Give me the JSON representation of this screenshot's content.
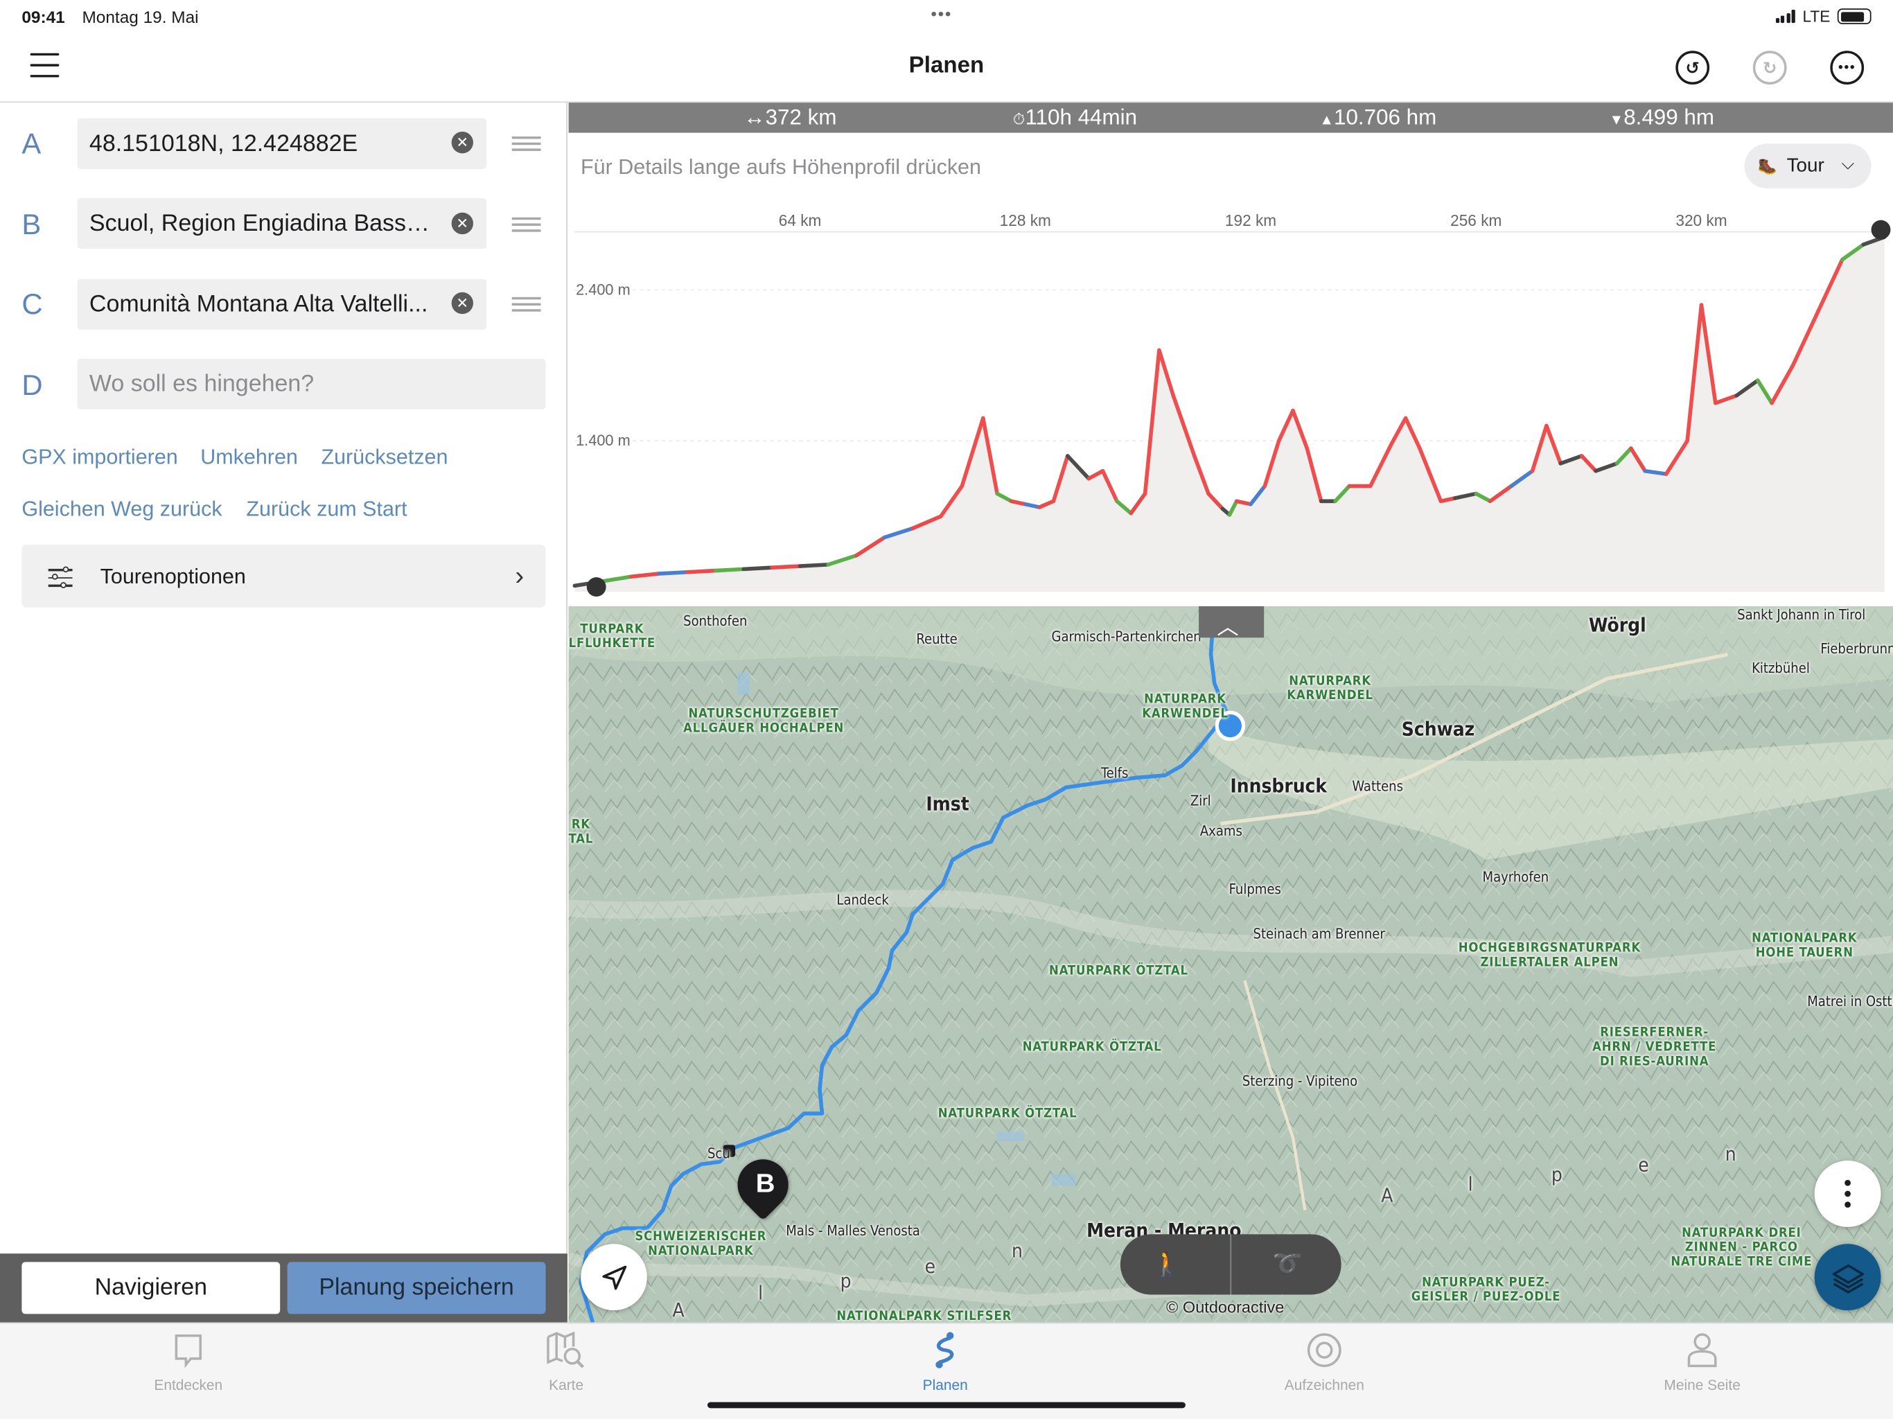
{
  "status_bar": {
    "time": "09:41",
    "date": "Montag 19. Mai",
    "network": "LTE"
  },
  "header": {
    "title": "Planen"
  },
  "waypoints": [
    {
      "letter": "A",
      "value": "48.151018N, 12.424882E",
      "placeholder": ""
    },
    {
      "letter": "B",
      "value": "Scuol, Region Engiadina Bassa...",
      "placeholder": ""
    },
    {
      "letter": "C",
      "value": "Comunità Montana Alta Valtelli...",
      "placeholder": ""
    },
    {
      "letter": "D",
      "value": "",
      "placeholder": "Wo soll es hingehen?"
    }
  ],
  "links": {
    "gpx_import": "GPX importieren",
    "reverse": "Umkehren",
    "reset": "Zurücksetzen",
    "same_way_back": "Gleichen Weg zurück",
    "back_to_start": "Zurück zum Start"
  },
  "tour_options": {
    "label": "Tourenoptionen"
  },
  "actions": {
    "navigate": "Navigieren",
    "save": "Planung speichern"
  },
  "stats": {
    "distance": "372 km",
    "duration": "110h 44min",
    "ascent": "10.706 hm",
    "descent": "8.499 hm"
  },
  "profile": {
    "hint": "Für Details lange aufs Höhenprofil drücken",
    "activity": "Tour"
  },
  "chart_data": {
    "type": "area",
    "x_tick_labels": [
      "64 km",
      "128 km",
      "192 km",
      "256 km",
      "320 km"
    ],
    "x_ticks": [
      64,
      128,
      192,
      256,
      320
    ],
    "y_tick_labels": [
      "2.400 m",
      "1.400 m"
    ],
    "y_ticks": [
      2400,
      1400
    ],
    "xlim": [
      0,
      372
    ],
    "ylim": [
      400,
      2800
    ],
    "x": [
      0,
      8,
      16,
      24,
      32,
      40,
      48,
      56,
      64,
      72,
      80,
      88,
      96,
      104,
      110,
      116,
      118,
      120,
      124,
      128,
      132,
      136,
      140,
      146,
      150,
      154,
      158,
      162,
      166,
      170,
      176,
      180,
      184,
      186,
      188,
      192,
      196,
      200,
      204,
      208,
      212,
      216,
      220,
      226,
      232,
      236,
      240,
      246,
      250,
      256,
      260,
      266,
      272,
      276,
      280,
      286,
      290,
      296,
      300,
      304,
      310,
      316,
      320,
      324,
      330,
      336,
      340,
      346,
      352,
      360,
      366,
      372
    ],
    "y": [
      440,
      470,
      500,
      520,
      530,
      540,
      550,
      560,
      570,
      580,
      640,
      760,
      820,
      900,
      1100,
      1550,
      1300,
      1050,
      1000,
      980,
      960,
      1000,
      1300,
      1150,
      1200,
      1000,
      920,
      1050,
      2000,
      1700,
      1300,
      1050,
      950,
      910,
      1000,
      980,
      1100,
      1400,
      1600,
      1350,
      1000,
      1000,
      1100,
      1100,
      1380,
      1550,
      1350,
      1000,
      1020,
      1050,
      1000,
      1100,
      1200,
      1500,
      1250,
      1300,
      1200,
      1250,
      1350,
      1200,
      1180,
      1400,
      2300,
      1650,
      1700,
      1800,
      1650,
      1900,
      2200,
      2600,
      2700,
      2750
    ]
  },
  "map": {
    "labels": {
      "sonthofen": "Sonthofen",
      "reutte": "Reutte",
      "garmisch": "Garmisch-Partenkirchen",
      "woergl": "Wörgl",
      "st_johann": "Sankt Johann in Tirol",
      "fieberbrunn": "Fieberbrunn",
      "kitzbuehel": "Kitzbühel",
      "schwaz": "Schwaz",
      "innsbruck": "Innsbruck",
      "wattens": "Wattens",
      "telfs": "Telfs",
      "zirl": "Zirl",
      "axams": "Axams",
      "imst": "Imst",
      "landeck": "Landeck",
      "fulpmes": "Fulpmes",
      "mayrhofen": "Mayrhofen",
      "steinach": "Steinach am Brenner",
      "matrei": "Matrei in Osttir",
      "sterzing": "Sterzing - Vipiteno",
      "scuol": "Scu",
      "mals": "Mals - Malles Venosta",
      "meran": "Meran - Merano"
    },
    "parks": {
      "p1": "TURPARK\nLFLUHKETTE",
      "p2": "NATURSCHUTZGEBIET\nALLGÄUER HOCHALPEN",
      "p3": "NATURPARK\nKARWENDEL",
      "p4": "NATURPARK\nKARWENDEL",
      "p5": "RK\nTAL",
      "p6": "NATURPARK ÖTZTAL",
      "p7": "NATURPARK ÖTZTAL",
      "p8": "NATURPARK ÖTZTAL",
      "p9": "HOCHGEBIRGSNATURPARK\nZILLERTALER ALPEN",
      "p10": "NATIONALPARK\nHOHE TAUERN",
      "p11": "RIESERFERNER-\nAHRN / VEDRETTE\nDI RIES-AURINA",
      "p12": "SCHWEIZERISCHER\nNATIONALPARK",
      "p13": "NATIONALPARK STILFSER",
      "p14": "NATURPARK DREI\nZINNEN - PARCO\nNATURALE TRE CIME",
      "p15": "NATURPARK PUEZ-\nGEISLER / PUEZ-ODLE"
    },
    "letters": {
      "l1": "e",
      "l2": "n",
      "l3": "p",
      "l4": "A",
      "l5": "l",
      "l6": "p",
      "l7": "e",
      "l8": "n",
      "l9": "A",
      "l10": "l",
      "l11": "p",
      "l12": "e",
      "l13": "n"
    },
    "waypoint_marker": "B",
    "copyright": "© Outdooractive"
  },
  "tabs": [
    {
      "label": "Entdecken",
      "icon": "discover-icon"
    },
    {
      "label": "Karte",
      "icon": "map-icon"
    },
    {
      "label": "Planen",
      "icon": "plan-icon"
    },
    {
      "label": "Aufzeichnen",
      "icon": "record-icon"
    },
    {
      "label": "Meine Seite",
      "icon": "profile-icon"
    }
  ],
  "colors": {
    "accent": "#3f7fc2",
    "link": "#5e8ab8",
    "save_button": "#6b95c8",
    "route": "#3a8ee6",
    "layers": "#135a8a"
  }
}
